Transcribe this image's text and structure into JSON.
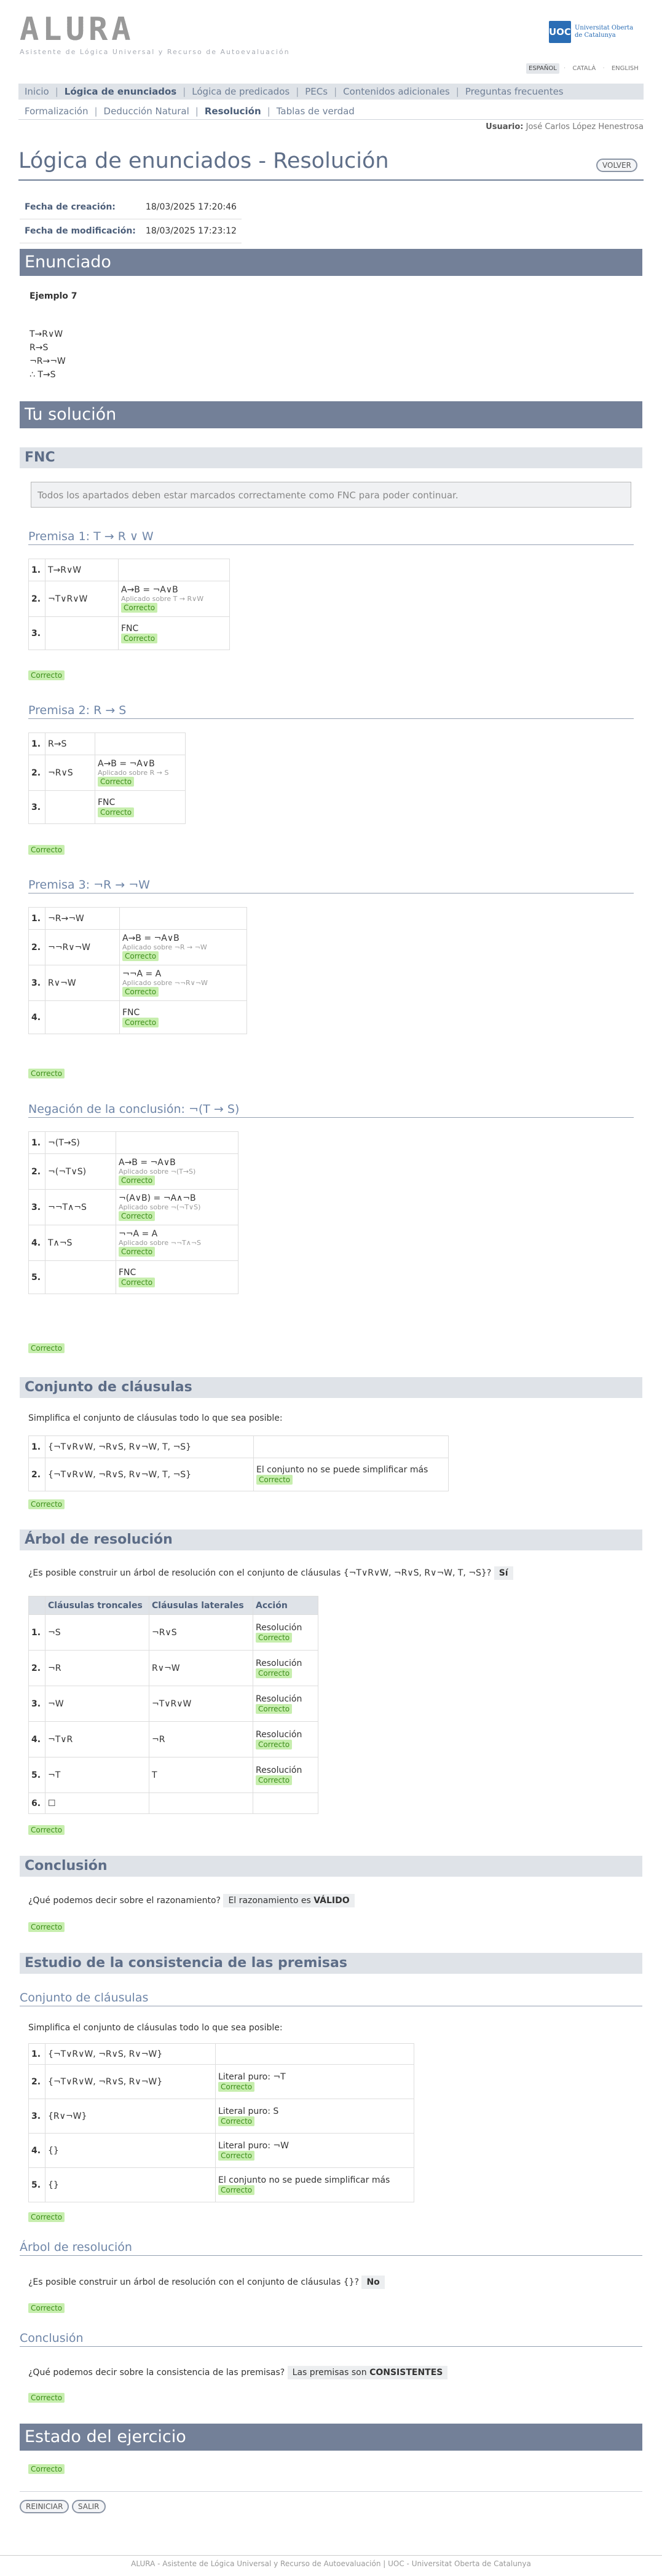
{
  "header": {
    "logo": "ALURA",
    "logo_sub": "Asistente de Lógica Universal y Recurso de Autoevaluación",
    "uoc_badge": "UOC",
    "uoc_name": "Universitat Oberta de Catalunya"
  },
  "languages": [
    "ESPAÑOL",
    "CATALÀ",
    "ENGLISH"
  ],
  "nav1": [
    "Inicio",
    "Lógica de enunciados",
    "Lógica de predicados",
    "PECs",
    "Contenidos adicionales",
    "Preguntas frecuentes"
  ],
  "nav2": [
    "Formalización",
    "Deducción Natural",
    "Resolución",
    "Tablas de verdad"
  ],
  "user": {
    "label": "Usuario:",
    "name": "José Carlos López Henestrosa"
  },
  "page_title": "Lógica de enunciados - Resolución",
  "volver": "VOLVER",
  "dates": [
    {
      "label": "Fecha de creación:",
      "value": "18/03/2025 17:20:46"
    },
    {
      "label": "Fecha de modificación:",
      "value": "18/03/2025 17:23:12"
    }
  ],
  "enunciado": {
    "heading": "Enunciado",
    "example": "Ejemplo 7",
    "lines": [
      "T→R∨W",
      "R→S",
      "¬R→¬W",
      "∴ T→S"
    ]
  },
  "solucion_heading": "Tu solución",
  "fnc": {
    "heading": "FNC",
    "note": "Todos los apartados deben estar marcados correctamente como FNC para poder continuar.",
    "correct": "Correcto",
    "premisas": [
      {
        "title": "Premisa 1: T → R ∨ W",
        "rows": [
          {
            "n": "1.",
            "f": "T→R∨W",
            "rule": "",
            "applied": "",
            "status": ""
          },
          {
            "n": "2.",
            "f": "¬T∨R∨W",
            "rule": "A→B = ¬A∨B",
            "applied": "Aplicado sobre T → R∨W",
            "status": "Correcto"
          },
          {
            "n": "3.",
            "f": "",
            "rule": "FNC",
            "applied": "",
            "status": "Correcto"
          }
        ]
      },
      {
        "title": "Premisa 2: R → S",
        "rows": [
          {
            "n": "1.",
            "f": "R→S",
            "rule": "",
            "applied": "",
            "status": ""
          },
          {
            "n": "2.",
            "f": "¬R∨S",
            "rule": "A→B = ¬A∨B",
            "applied": "Aplicado sobre R → S",
            "status": "Correcto"
          },
          {
            "n": "3.",
            "f": "",
            "rule": "FNC",
            "applied": "",
            "status": "Correcto"
          }
        ]
      },
      {
        "title": "Premisa 3: ¬R → ¬W",
        "rows": [
          {
            "n": "1.",
            "f": "¬R→¬W",
            "rule": "",
            "applied": "",
            "status": ""
          },
          {
            "n": "2.",
            "f": "¬¬R∨¬W",
            "rule": "A→B = ¬A∨B",
            "applied": "Aplicado sobre ¬R → ¬W",
            "status": "Correcto"
          },
          {
            "n": "3.",
            "f": "R∨¬W",
            "rule": "¬¬A = A",
            "applied": "Aplicado sobre ¬¬R∨¬W",
            "status": "Correcto"
          },
          {
            "n": "4.",
            "f": "",
            "rule": "FNC",
            "applied": "",
            "status": "Correcto"
          }
        ]
      },
      {
        "title": "Negación de la conclusión: ¬(T → S)",
        "rows": [
          {
            "n": "1.",
            "f": "¬(T→S)",
            "rule": "",
            "applied": "",
            "status": ""
          },
          {
            "n": "2.",
            "f": "¬(¬T∨S)",
            "rule": "A→B = ¬A∨B",
            "applied": "Aplicado sobre ¬(T→S)",
            "status": "Correcto"
          },
          {
            "n": "3.",
            "f": "¬¬T∧¬S",
            "rule": "¬(A∨B) = ¬A∧¬B",
            "applied": "Aplicado sobre ¬(¬T∨S)",
            "status": "Correcto"
          },
          {
            "n": "4.",
            "f": "T∧¬S",
            "rule": "¬¬A = A",
            "applied": "Aplicado sobre ¬¬T∧¬S",
            "status": "Correcto"
          },
          {
            "n": "5.",
            "f": "",
            "rule": "FNC",
            "applied": "",
            "status": "Correcto"
          }
        ]
      }
    ]
  },
  "clausulas": {
    "heading": "Conjunto de cláusulas",
    "intro": "Simplifica el conjunto de cláusulas todo lo que sea posible:",
    "rows": [
      {
        "n": "1.",
        "f": "{¬T∨R∨W, ¬R∨S, R∨¬W, T, ¬S}",
        "note": "",
        "status": ""
      },
      {
        "n": "2.",
        "f": "{¬T∨R∨W, ¬R∨S, R∨¬W, T, ¬S}",
        "note": "El conjunto no se puede simplificar más",
        "status": "Correcto"
      }
    ],
    "correct": "Correcto"
  },
  "arbol": {
    "heading": "Árbol de resolución",
    "question": "¿Es posible construir un árbol de resolución con el conjunto de cláusulas {¬T∨R∨W, ¬R∨S, R∨¬W, T, ¬S}?",
    "answer": "Sí",
    "columns": [
      "Cláusulas troncales",
      "Cláusulas laterales",
      "Acción"
    ],
    "rows": [
      {
        "n": "1.",
        "t": "¬S",
        "l": "¬R∨S",
        "a": "Resolución",
        "s": "Correcto"
      },
      {
        "n": "2.",
        "t": "¬R",
        "l": "R∨¬W",
        "a": "Resolución",
        "s": "Correcto"
      },
      {
        "n": "3.",
        "t": "¬W",
        "l": "¬T∨R∨W",
        "a": "Resolución",
        "s": "Correcto"
      },
      {
        "n": "4.",
        "t": "¬T∨R",
        "l": "¬R",
        "a": "Resolución",
        "s": "Correcto"
      },
      {
        "n": "5.",
        "t": "¬T",
        "l": "T",
        "a": "Resolución",
        "s": "Correcto"
      },
      {
        "n": "6.",
        "t": "☐",
        "l": "",
        "a": "",
        "s": ""
      }
    ],
    "correct": "Correcto"
  },
  "conclusion": {
    "heading": "Conclusión",
    "question": "¿Qué podemos decir sobre el razonamiento?",
    "answer_pre": "El razonamiento es",
    "answer_bold": "VÁLIDO",
    "correct": "Correcto"
  },
  "consistencia": {
    "heading": "Estudio de la consistencia de las premisas",
    "sub1": "Conjunto de cláusulas",
    "intro": "Simplifica el conjunto de cláusulas todo lo que sea posible:",
    "rows": [
      {
        "n": "1.",
        "f": "{¬T∨R∨W, ¬R∨S, R∨¬W}",
        "note": "",
        "status": ""
      },
      {
        "n": "2.",
        "f": "{¬T∨R∨W, ¬R∨S, R∨¬W}",
        "note": "Literal puro: ¬T",
        "status": "Correcto"
      },
      {
        "n": "3.",
        "f": "{R∨¬W}",
        "note": "Literal puro: S",
        "status": "Correcto"
      },
      {
        "n": "4.",
        "f": "{}",
        "note": "Literal puro: ¬W",
        "status": "Correcto"
      },
      {
        "n": "5.",
        "f": "{}",
        "note": "El conjunto no se puede simplificar más",
        "status": "Correcto"
      }
    ],
    "correct1": "Correcto",
    "sub2": "Árbol de resolución",
    "question2": "¿Es posible construir un árbol de resolución con el conjunto de cláusulas {}?",
    "answer2": "No",
    "correct2": "Correcto",
    "sub3": "Conclusión",
    "question3": "¿Qué podemos decir sobre la consistencia de las premisas?",
    "answer3_pre": "Las premisas son",
    "answer3_bold": "CONSISTENTES",
    "correct3": "Correcto"
  },
  "estado": {
    "heading": "Estado del ejercicio",
    "correct": "Correcto"
  },
  "buttons": {
    "reiniciar": "REINICIAR",
    "salir": "SALIR"
  },
  "footer": "ALURA - Asistente de Lógica Universal y Recurso de Autoevaluación | UOC - Universitat Oberta de Catalunya"
}
